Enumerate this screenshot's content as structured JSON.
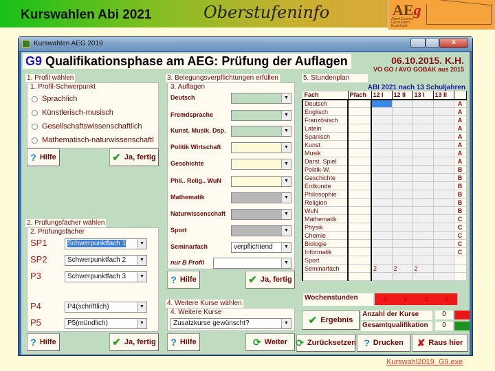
{
  "slide": {
    "title": "Kurswahlen Abi 2021",
    "subtitle": "Oberstufeninfo",
    "logo_text": "AE",
    "logo_g": "g",
    "logo_sub": "Albert Einstein Gymnasium Buxtehude",
    "footer_link": "Kurswahl2019_G9.exe"
  },
  "window": {
    "title": "Kurswahlen AEG 2019",
    "close_label": "x"
  },
  "header": {
    "g9": "G9",
    "heading": " Qualifikationsphase am AEG: Prüfung der Auflagen",
    "date": "06.10.2015. K.H.",
    "vo": "VO GO / AVO GOBAK aus 2015",
    "abi": "ABI 2021 nach 13 Schuljahren"
  },
  "step1": {
    "legend": "1. Profil wählen",
    "caption": "1. Profil-Schwerpunkt",
    "options": [
      "Sprachlich",
      "Künstlerisch-musisch",
      "Gesellschaftswissenschaftlich",
      "Mathematisch-naturwissenschaftl"
    ],
    "help": "Hilfe",
    "done": "Ja, fertig"
  },
  "step2": {
    "legend": "2. Prüfungsfächer wählen",
    "caption": "2. Prüfungsfächer",
    "rows": [
      {
        "label": "SP1",
        "value": "Schwerpunktfach 1"
      },
      {
        "label": "SP2",
        "value": "Schwerpunktfach 2"
      },
      {
        "label": "P3",
        "value": "Schwerpunktfach 3"
      },
      {
        "label": "P4",
        "value": "P4(schriftlich)"
      },
      {
        "label": "P5",
        "value": "P5(mündlich)"
      }
    ],
    "help": "Hilfe",
    "done": "Ja, fertig"
  },
  "step3": {
    "legend": "3. Belegungsverpflichtungen erfüllen",
    "caption": "3. Auflagen",
    "rows": [
      {
        "label": "Deutsch",
        "value": ""
      },
      {
        "label": "Fremdsprache",
        "value": ""
      },
      {
        "label": "Kunst. Musik. Dsp.",
        "value": ""
      },
      {
        "label": "Politik Wirtschaft",
        "value": ""
      },
      {
        "label": "Geschichte",
        "value": ""
      },
      {
        "label": "Phil.. Relig.. WuN",
        "value": ""
      },
      {
        "label": "Mathematik",
        "value": ""
      },
      {
        "label": "Naturwissenschaft",
        "value": ""
      },
      {
        "label": "Sport",
        "value": ""
      },
      {
        "label": "Seminarfach",
        "value": "verpflichtend"
      },
      {
        "label": "nur B Profil",
        "value": ""
      }
    ],
    "help": "Hilfe",
    "done": "Ja, fertig"
  },
  "step4": {
    "legend": "4. Weitere Kurse wählen",
    "caption": "4. Weitere Kurse",
    "value": "Zusatzkurse gewünscht?",
    "help": "Hilfe",
    "next": "Weiter"
  },
  "step5": {
    "legend": "5. Stundenplan",
    "columns": [
      "Fach",
      "Pfach",
      "12 I",
      "12 II",
      "13 I",
      "13 II",
      ""
    ],
    "rows": [
      {
        "fach": "Deutsch",
        "s": [
          "",
          "",
          "",
          ""
        ],
        "grp": "A"
      },
      {
        "fach": "Englisch",
        "s": [
          "",
          "",
          "",
          ""
        ],
        "grp": "A"
      },
      {
        "fach": "Französisch",
        "s": [
          "",
          "",
          "",
          ""
        ],
        "grp": "A"
      },
      {
        "fach": "Latein",
        "s": [
          "",
          "",
          "",
          ""
        ],
        "grp": "A"
      },
      {
        "fach": "Spanisch",
        "s": [
          "",
          "",
          "",
          ""
        ],
        "grp": "A"
      },
      {
        "fach": "Kunst",
        "s": [
          "",
          "",
          "",
          ""
        ],
        "grp": "A"
      },
      {
        "fach": "Musik",
        "s": [
          "",
          "",
          "",
          ""
        ],
        "grp": "A"
      },
      {
        "fach": "Darst. Spiel",
        "s": [
          "",
          "",
          "",
          ""
        ],
        "grp": "A"
      },
      {
        "fach": "Politik-W.",
        "s": [
          "",
          "",
          "",
          ""
        ],
        "grp": "B"
      },
      {
        "fach": "Geschichte",
        "s": [
          "",
          "",
          "",
          ""
        ],
        "grp": "B"
      },
      {
        "fach": "Erdkunde",
        "s": [
          "",
          "",
          "",
          ""
        ],
        "grp": "B"
      },
      {
        "fach": "Philosophie",
        "s": [
          "",
          "",
          "",
          ""
        ],
        "grp": "B"
      },
      {
        "fach": "Religion",
        "s": [
          "",
          "",
          "",
          ""
        ],
        "grp": "B"
      },
      {
        "fach": "WuN",
        "s": [
          "",
          "",
          "",
          ""
        ],
        "grp": "B"
      },
      {
        "fach": "Mathematik",
        "s": [
          "",
          "",
          "",
          ""
        ],
        "grp": "C"
      },
      {
        "fach": "Physik",
        "s": [
          "",
          "",
          "",
          ""
        ],
        "grp": "C"
      },
      {
        "fach": "Chemie",
        "s": [
          "",
          "",
          "",
          ""
        ],
        "grp": "C"
      },
      {
        "fach": "Biologie",
        "s": [
          "",
          "",
          "",
          ""
        ],
        "grp": "C"
      },
      {
        "fach": "Informatik",
        "s": [
          "",
          "",
          "",
          ""
        ],
        "grp": "C"
      },
      {
        "fach": "Sport",
        "s": [
          "",
          "",
          "",
          ""
        ],
        "grp": ""
      },
      {
        "fach": "Seminarfach",
        "s": [
          "2",
          "2",
          "2",
          ""
        ],
        "grp": ""
      },
      {
        "fach": "",
        "s": [
          "",
          "",
          "",
          ""
        ],
        "grp": ""
      }
    ],
    "wochenstunden_label": "Wochenstunden",
    "wochenstunden": [
      "2",
      "2",
      "2",
      "0"
    ]
  },
  "result": {
    "ergebnis": "Ergebnis",
    "anzahl_label": "Anzahl der Kurse",
    "anzahl_value": "0",
    "anzahl_status_color": "#e81818",
    "gesamt_label": "Gesamtqualifikation",
    "gesamt_value": "0",
    "gesamt_status_color": "#209020"
  },
  "bottom": {
    "reset": "Zurücksetzen",
    "print": "Drucken",
    "exit": "Raus hier"
  }
}
